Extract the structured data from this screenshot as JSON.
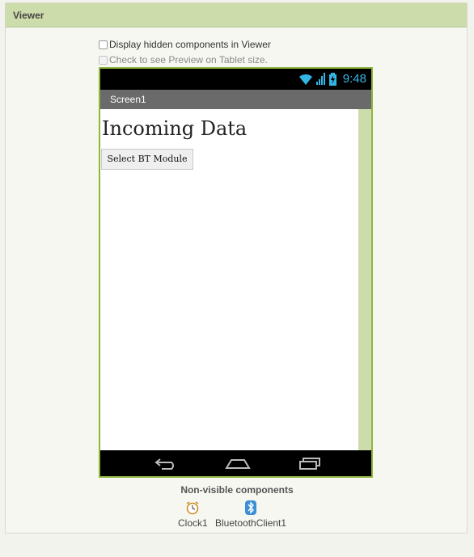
{
  "panel": {
    "title": "Viewer"
  },
  "options": {
    "hidden_components": "Display hidden components in Viewer",
    "tablet_preview": "Check to see Preview on Tablet size."
  },
  "phone": {
    "status": {
      "time": "9:48",
      "icons": [
        "wifi-icon",
        "signal-icon",
        "battery-charging-icon"
      ]
    },
    "screen_title": "Screen1",
    "components": {
      "label_text": "Incoming Data",
      "button_text": "Select BT Module"
    },
    "nav": [
      "back-icon",
      "home-icon",
      "recent-apps-icon"
    ]
  },
  "non_visible": {
    "title": "Non-visible components",
    "items": [
      {
        "label": "Clock1",
        "icon": "clock-icon"
      },
      {
        "label": "BluetoothClient1",
        "icon": "bluetooth-icon"
      }
    ]
  },
  "colors": {
    "accent_green": "#cddcab",
    "phone_border": "#8fb73e",
    "clock_blue": "#33b5e5"
  }
}
